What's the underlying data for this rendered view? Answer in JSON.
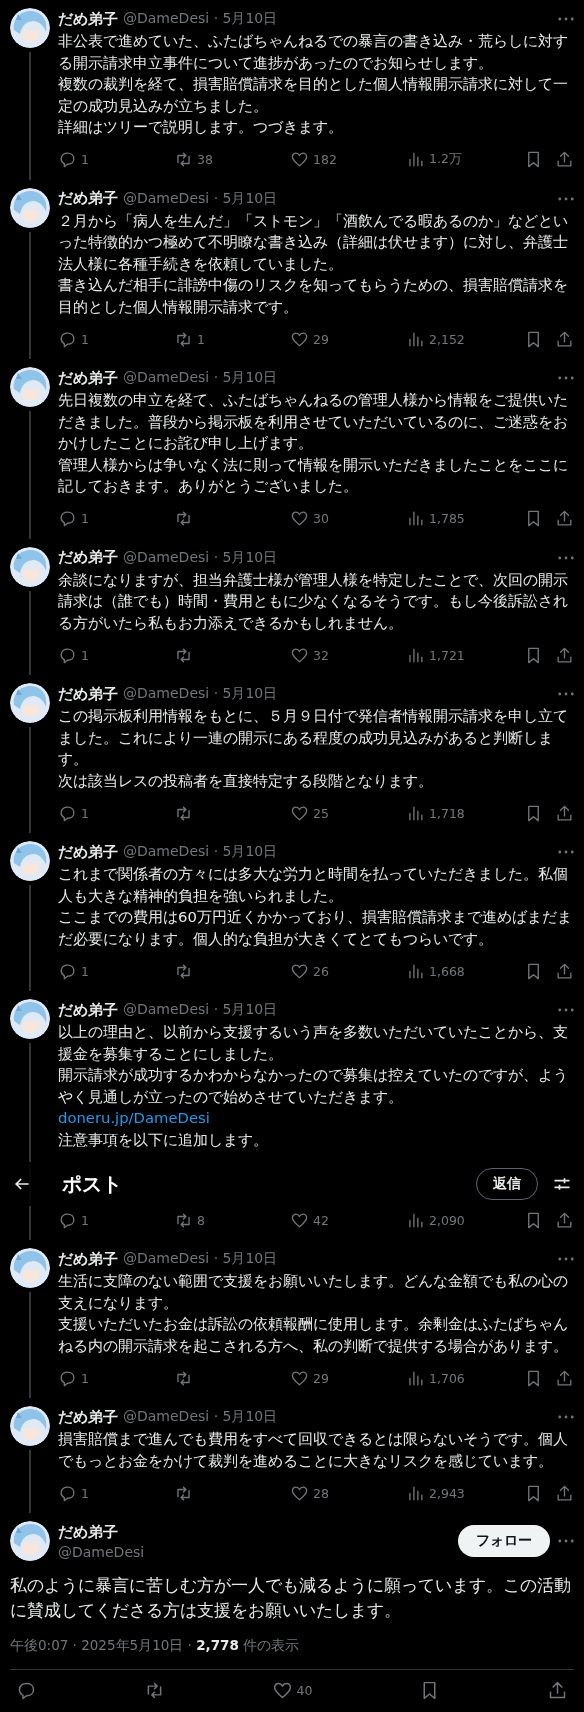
{
  "thread": [
    {
      "name": "だめ弟子",
      "byline": "@DameDesi · 5月10日",
      "paragraphs": [
        "非公表で進めていた、ふたばちゃんねるでの暴言の書き込み・荒らしに対する開示請求申立事件について進捗があったのでお知らせします。",
        "複数の裁判を経て、損害賠償請求を目的とした個人情報開示請求に対して一定の成功見込みが立ちました。",
        "詳細はツリーで説明します。つづきます。"
      ],
      "replies": "1",
      "retweets": "38",
      "likes": "182",
      "views": "1.2万"
    },
    {
      "name": "だめ弟子",
      "byline": "@DameDesi · 5月10日",
      "paragraphs": [
        "２月から「病人を生んだ」「ストモン」「酒飲んでる暇あるのか」などといった特徴的かつ極めて不明瞭な書き込み（詳細は伏せます）に対し、弁護士法人様に各種手続きを依頼していました。",
        "書き込んだ相手に誹謗中傷のリスクを知ってもらうための、損害賠償請求を目的とした個人情報開示請求です。"
      ],
      "replies": "1",
      "retweets": "1",
      "likes": "29",
      "views": "2,152"
    },
    {
      "name": "だめ弟子",
      "byline": "@DameDesi · 5月10日",
      "paragraphs": [
        "先日複数の申立を経て、ふたばちゃんねるの管理人様から情報をご提供いただきました。普段から掲示板を利用させていただいているのに、ご迷惑をおかけしたことにお詫び申し上げます。",
        "管理人様からは争いなく法に則って情報を開示いただきましたことをここに記しておきます。ありがとうございました。"
      ],
      "replies": "1",
      "likes": "30",
      "views": "1,785"
    },
    {
      "name": "だめ弟子",
      "byline": "@DameDesi · 5月10日",
      "paragraphs": [
        "余談になりますが、担当弁護士様が管理人様を特定したことで、次回の開示請求は（誰でも）時間・費用ともに少なくなるそうです。もし今後訴訟される方がいたら私もお力添えできるかもしれません。"
      ],
      "replies": "1",
      "likes": "32",
      "views": "1,721"
    },
    {
      "name": "だめ弟子",
      "byline": "@DameDesi · 5月10日",
      "paragraphs": [
        "この掲示板利用情報をもとに、５月９日付で発信者情報開示請求を申し立てました。これにより一連の開示にある程度の成功見込みがあると判断します。",
        "次は該当レスの投稿者を直接特定する段階となります。"
      ],
      "replies": "1",
      "likes": "25",
      "views": "1,718"
    },
    {
      "name": "だめ弟子",
      "byline": "@DameDesi · 5月10日",
      "paragraphs": [
        "これまで関係者の方々には多大な労力と時間を払っていただきました。私個人も大きな精神的負担を強いられました。",
        "ここまでの費用は60万円近くかかっており、損害賠償請求まで進めばまだまだ必要になります。個人的な負担が大きくてとてもつらいです。"
      ],
      "replies": "1",
      "likes": "26",
      "views": "1,668"
    },
    {
      "name": "だめ弟子",
      "byline": "@DameDesi · 5月10日",
      "paragraphs": [
        "以上の理由と、以前から支援するいう声を多数いただいていたことから、支援金を募集することにしました。",
        "開示請求が成功するかわからなかったので募集は控えていたのですが、ようやく見通しが立ったので始めさせていただきます。"
      ],
      "link": "doneru.jp/DameDesi",
      "note": "注意事項を以下に追加します。",
      "replies": "1",
      "retweets": "8",
      "likes": "42",
      "views": "2,090"
    },
    {
      "name": "だめ弟子",
      "byline": "@DameDesi · 5月10日",
      "paragraphs": [
        "生活に支障のない範囲で支援をお願いいたします。どんな金額でも私の心の支えになります。",
        "支援いただいたお金は訴訟の依頼報酬に使用します。余剰金はふたばちゃんねる内の開示請求を起こされる方へ、私の判断で提供する場合があります。"
      ],
      "replies": "1",
      "likes": "29",
      "views": "1,706"
    },
    {
      "name": "だめ弟子",
      "byline": "@DameDesi · 5月10日",
      "paragraphs": [
        "損害賠償まで進んでも費用をすべて回収できるとは限らないそうです。個人でもっとお金をかけて裁判を進めることに大きなリスクを感じています。"
      ],
      "replies": "1",
      "likes": "28",
      "views": "2,943"
    }
  ],
  "header": {
    "title": "ポスト",
    "reply_button": "返信"
  },
  "main": {
    "name": "だめ弟子",
    "handle": "@DameDesi",
    "follow": "フォロー",
    "text": "私のように暴言に苦しむ方が一人でも減るように願っています。この活動に賛成してくださる方は支援をお願いいたします。",
    "meta": "午後0:07 · 2025年5月10日 · **2,778** 件の表示",
    "likes": "40"
  }
}
